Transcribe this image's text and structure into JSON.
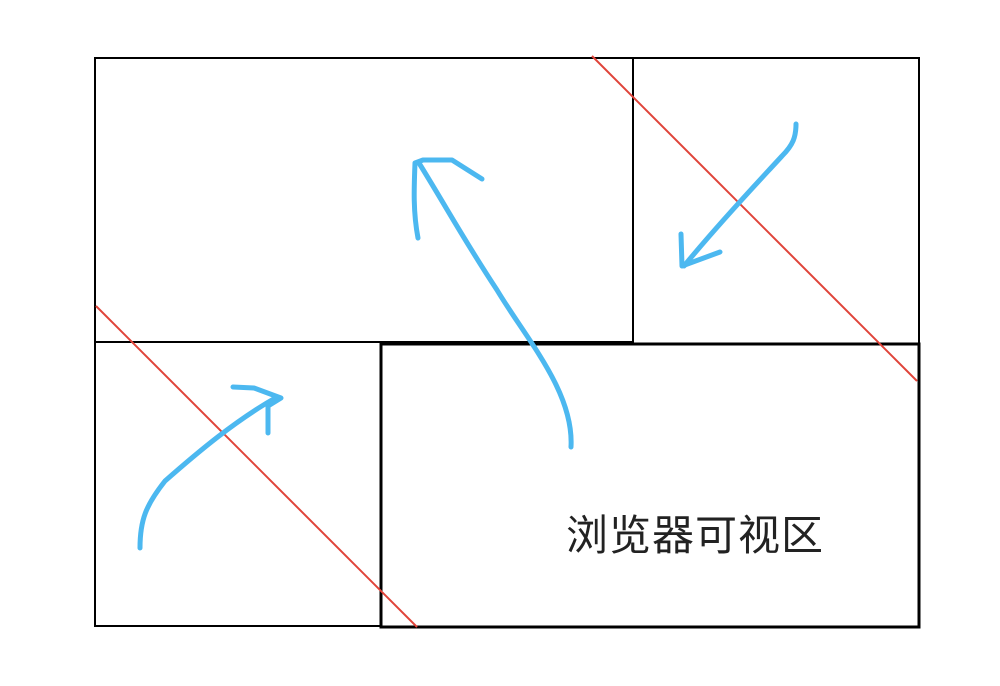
{
  "diagram": {
    "viewport_label": "浏览器可视区",
    "colors": {
      "border": "#000000",
      "diagonal": "#e0443a",
      "arrow": "#4cb8f0",
      "label": "#222222"
    },
    "regions": [
      "top-left-box",
      "top-right-box",
      "bottom-left-box",
      "browser-viewport-box"
    ],
    "arrows": [
      "arrow-viewport-to-top-left",
      "arrow-into-top-right",
      "arrow-into-bottom-left"
    ]
  }
}
